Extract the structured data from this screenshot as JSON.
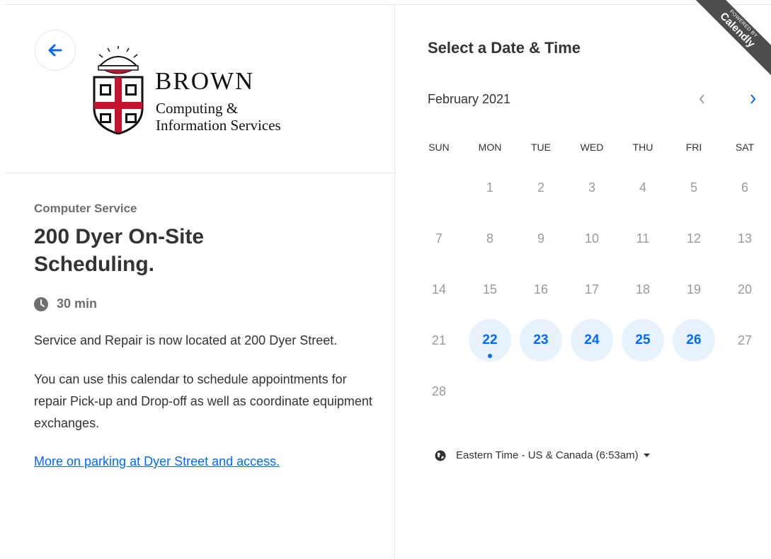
{
  "ribbon": {
    "powered": "POWERED BY",
    "brand": "Calendly"
  },
  "logo": {
    "name": "BROWN",
    "subtitle_line1": "Computing &",
    "subtitle_line2": "Information Services"
  },
  "event": {
    "service": "Computer Service",
    "title_line1": "200 Dyer On-Site",
    "title_line2": "Scheduling.",
    "duration": "30 min",
    "description_1": "Service and Repair is now located at 200 Dyer Street.",
    "description_2": "You can use this calendar to schedule appointments for repair Pick-up and Drop-off as well as coordinate equipment exchanges.",
    "link_text": "More on parking at Dyer Street and access."
  },
  "picker": {
    "title": "Select a Date & Time",
    "month": "February 2021",
    "weekdays": [
      "SUN",
      "MON",
      "TUE",
      "WED",
      "THU",
      "FRI",
      "SAT"
    ],
    "timezone": "Eastern Time - US & Canada (6:53am)"
  },
  "calendar": {
    "weeks": [
      [
        {
          "d": ""
        },
        {
          "d": "1"
        },
        {
          "d": "2"
        },
        {
          "d": "3"
        },
        {
          "d": "4"
        },
        {
          "d": "5"
        },
        {
          "d": "6"
        }
      ],
      [
        {
          "d": "7"
        },
        {
          "d": "8"
        },
        {
          "d": "9"
        },
        {
          "d": "10"
        },
        {
          "d": "11"
        },
        {
          "d": "12"
        },
        {
          "d": "13"
        }
      ],
      [
        {
          "d": "14"
        },
        {
          "d": "15"
        },
        {
          "d": "16"
        },
        {
          "d": "17"
        },
        {
          "d": "18"
        },
        {
          "d": "19"
        },
        {
          "d": "20"
        }
      ],
      [
        {
          "d": "21"
        },
        {
          "d": "22",
          "available": true,
          "today": true
        },
        {
          "d": "23",
          "available": true
        },
        {
          "d": "24",
          "available": true
        },
        {
          "d": "25",
          "available": true
        },
        {
          "d": "26",
          "available": true
        },
        {
          "d": "27"
        }
      ],
      [
        {
          "d": "28"
        }
      ]
    ]
  },
  "colors": {
    "accent": "#0069ff",
    "available_bg": "#e8f2ff",
    "muted": "#9a9a9a"
  },
  "icons": {
    "back": "arrow-left-icon",
    "clock": "clock-icon",
    "prev": "chevron-left-icon",
    "next": "chevron-right-icon",
    "globe": "globe-icon",
    "caret": "caret-down-icon"
  }
}
